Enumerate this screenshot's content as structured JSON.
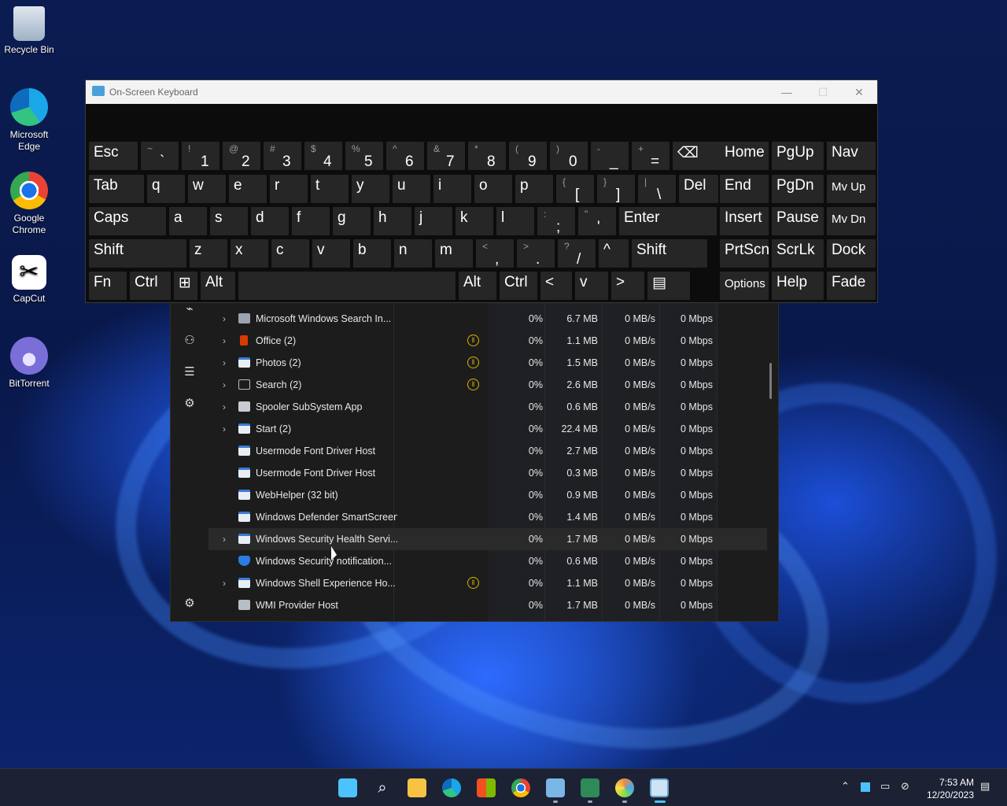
{
  "desktop": {
    "icons": [
      {
        "label": "Recycle Bin"
      },
      {
        "label": "Microsoft Edge"
      },
      {
        "label": "Google Chrome"
      },
      {
        "label": "CapCut"
      },
      {
        "label": "BitTorrent"
      }
    ]
  },
  "osk": {
    "title": "On-Screen Keyboard",
    "rows": [
      [
        {
          "label": "Esc"
        },
        {
          "shift": "~",
          "main": "`"
        },
        {
          "shift": "!",
          "main": "1"
        },
        {
          "shift": "@",
          "main": "2"
        },
        {
          "shift": "#",
          "main": "3"
        },
        {
          "shift": "$",
          "main": "4"
        },
        {
          "shift": "%",
          "main": "5"
        },
        {
          "shift": "^",
          "main": "6"
        },
        {
          "shift": "&",
          "main": "7"
        },
        {
          "shift": "*",
          "main": "8"
        },
        {
          "shift": "(",
          "main": "9"
        },
        {
          "shift": ")",
          "main": "0"
        },
        {
          "shift": "-",
          "main": "_"
        },
        {
          "shift": "+",
          "main": "="
        },
        {
          "label": "⌫"
        }
      ],
      [
        {
          "label": "Tab"
        },
        {
          "label": "q"
        },
        {
          "label": "w"
        },
        {
          "label": "e"
        },
        {
          "label": "r"
        },
        {
          "label": "t"
        },
        {
          "label": "y"
        },
        {
          "label": "u"
        },
        {
          "label": "i"
        },
        {
          "label": "o"
        },
        {
          "label": "p"
        },
        {
          "shift": "{",
          "main": "["
        },
        {
          "shift": "}",
          "main": "]"
        },
        {
          "shift": "|",
          "main": "\\"
        },
        {
          "label": "Del"
        }
      ],
      [
        {
          "label": "Caps"
        },
        {
          "label": "a"
        },
        {
          "label": "s"
        },
        {
          "label": "d"
        },
        {
          "label": "f"
        },
        {
          "label": "g"
        },
        {
          "label": "h"
        },
        {
          "label": "j"
        },
        {
          "label": "k"
        },
        {
          "label": "l"
        },
        {
          "shift": ":",
          "main": ";"
        },
        {
          "shift": "\"",
          "main": "'"
        },
        {
          "label": "Enter"
        }
      ],
      [
        {
          "label": "Shift"
        },
        {
          "label": "z"
        },
        {
          "label": "x"
        },
        {
          "label": "c"
        },
        {
          "label": "v"
        },
        {
          "label": "b"
        },
        {
          "label": "n"
        },
        {
          "label": "m"
        },
        {
          "shift": "<",
          "main": ","
        },
        {
          "shift": ">",
          "main": "."
        },
        {
          "shift": "?",
          "main": "/"
        },
        {
          "label": "^"
        },
        {
          "label": "Shift"
        }
      ],
      [
        {
          "label": "Fn"
        },
        {
          "label": "Ctrl"
        },
        {
          "label": "⊞"
        },
        {
          "label": "Alt"
        },
        {
          "label": ""
        },
        {
          "label": "Alt"
        },
        {
          "label": "Ctrl"
        },
        {
          "label": "<"
        },
        {
          "label": "v"
        },
        {
          "label": ">"
        },
        {
          "label": "▤"
        }
      ]
    ],
    "side": [
      [
        "Home",
        "PgUp",
        "Nav"
      ],
      [
        "End",
        "PgDn",
        "Mv Up"
      ],
      [
        "Insert",
        "Pause",
        "Mv Dn"
      ],
      [
        "PrtScn",
        "ScrLk",
        "Dock"
      ],
      [
        "Options",
        "Help",
        "Fade"
      ]
    ]
  },
  "task_manager": {
    "processes": [
      {
        "name": "Microsoft Windows Search In...",
        "expand": true,
        "paused": false,
        "cpu": "0%",
        "memory": "6.7 MB",
        "disk": "0 MB/s",
        "network": "0 Mbps",
        "icon": "search-indexer-icon"
      },
      {
        "name": "Office (2)",
        "expand": true,
        "paused": true,
        "cpu": "0%",
        "memory": "1.1 MB",
        "disk": "0 MB/s",
        "network": "0 Mbps",
        "icon": "office-icon"
      },
      {
        "name": "Photos (2)",
        "expand": true,
        "paused": true,
        "cpu": "0%",
        "memory": "1.5 MB",
        "disk": "0 MB/s",
        "network": "0 Mbps",
        "icon": "app-window-icon"
      },
      {
        "name": "Search (2)",
        "expand": true,
        "paused": true,
        "cpu": "0%",
        "memory": "2.6 MB",
        "disk": "0 MB/s",
        "network": "0 Mbps",
        "icon": "search-app-icon"
      },
      {
        "name": "Spooler SubSystem App",
        "expand": true,
        "paused": false,
        "cpu": "0%",
        "memory": "0.6 MB",
        "disk": "0 MB/s",
        "network": "0 Mbps",
        "icon": "printer-icon"
      },
      {
        "name": "Start (2)",
        "expand": true,
        "paused": false,
        "cpu": "0%",
        "memory": "22.4 MB",
        "disk": "0 MB/s",
        "network": "0 Mbps",
        "icon": "app-window-icon"
      },
      {
        "name": "Usermode Font Driver Host",
        "expand": false,
        "paused": false,
        "cpu": "0%",
        "memory": "2.7 MB",
        "disk": "0 MB/s",
        "network": "0 Mbps",
        "icon": "app-window-icon"
      },
      {
        "name": "Usermode Font Driver Host",
        "expand": false,
        "paused": false,
        "cpu": "0%",
        "memory": "0.3 MB",
        "disk": "0 MB/s",
        "network": "0 Mbps",
        "icon": "app-window-icon"
      },
      {
        "name": "WebHelper (32 bit)",
        "expand": false,
        "paused": false,
        "cpu": "0%",
        "memory": "0.9 MB",
        "disk": "0 MB/s",
        "network": "0 Mbps",
        "icon": "app-window-icon"
      },
      {
        "name": "Windows Defender SmartScreen",
        "expand": false,
        "paused": false,
        "cpu": "0%",
        "memory": "1.4 MB",
        "disk": "0 MB/s",
        "network": "0 Mbps",
        "icon": "app-window-icon"
      },
      {
        "name": "Windows Security Health Servi...",
        "expand": true,
        "paused": false,
        "cpu": "0%",
        "memory": "1.7 MB",
        "disk": "0 MB/s",
        "network": "0 Mbps",
        "icon": "app-window-icon"
      },
      {
        "name": "Windows Security notification...",
        "expand": false,
        "paused": false,
        "cpu": "0%",
        "memory": "0.6 MB",
        "disk": "0 MB/s",
        "network": "0 Mbps",
        "icon": "shield-icon"
      },
      {
        "name": "Windows Shell Experience Ho...",
        "expand": true,
        "paused": true,
        "cpu": "0%",
        "memory": "1.1 MB",
        "disk": "0 MB/s",
        "network": "0 Mbps",
        "icon": "app-window-icon"
      },
      {
        "name": "WMI Provider Host",
        "expand": false,
        "paused": false,
        "cpu": "0%",
        "memory": "1.7 MB",
        "disk": "0 MB/s",
        "network": "0 Mbps",
        "icon": "wmi-icon"
      }
    ]
  },
  "taskbar": {
    "time": "7:53 AM",
    "date": "12/20/2023"
  }
}
